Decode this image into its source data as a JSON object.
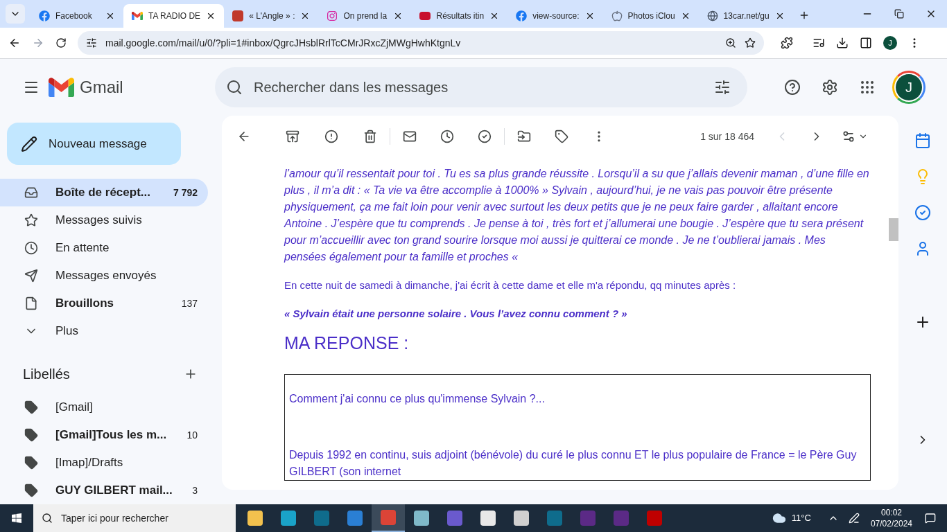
{
  "browser": {
    "tabs": [
      {
        "kind": "facebook",
        "title": "Facebook",
        "selected": false
      },
      {
        "kind": "gmail",
        "title": "TA RADIO DE",
        "selected": true
      },
      {
        "kind": "news",
        "title": "« L'Angle » :",
        "selected": false
      },
      {
        "kind": "instagram",
        "title": "On prend la",
        "selected": false
      },
      {
        "kind": "train",
        "title": "Résultats itin",
        "selected": false
      },
      {
        "kind": "facebook",
        "title": "view-source:",
        "selected": false
      },
      {
        "kind": "apple",
        "title": "Photos iClou",
        "selected": false
      },
      {
        "kind": "globe",
        "title": "13car.net/gu",
        "selected": false
      }
    ],
    "url": "mail.google.com/mail/u/0/?pli=1#inbox/QgrcJHsblRrlTcCMrJRxcZjMWgHwhKtgnLv",
    "profile_initial": "J"
  },
  "gmail": {
    "logo_text": "Gmail",
    "search_placeholder": "Rechercher dans les messages",
    "account_initial": "J",
    "compose_label": "Nouveau message",
    "nav": [
      {
        "kind": "inbox",
        "label": "Boîte de récept...",
        "count": "7 792",
        "bold": true,
        "selected": true
      },
      {
        "kind": "star",
        "label": "Messages suivis",
        "bold": false,
        "selected": false
      },
      {
        "kind": "clock",
        "label": "En attente",
        "bold": false,
        "selected": false
      },
      {
        "kind": "send",
        "label": "Messages envoyés",
        "bold": false,
        "selected": false
      },
      {
        "kind": "file",
        "label": "Brouillons",
        "count": "137",
        "bold": true,
        "selected": false
      },
      {
        "kind": "chevron",
        "label": "Plus",
        "bold": false,
        "selected": false
      }
    ],
    "labels_title": "Libellés",
    "labels": [
      {
        "label": "[Gmail]",
        "bold": false
      },
      {
        "label": "[Gmail]Tous les m...",
        "count": "10",
        "bold": true
      },
      {
        "label": "[Imap]/Drafts",
        "bold": false
      },
      {
        "label": "GUY GILBERT mail...",
        "count": "3",
        "bold": true
      }
    ],
    "pagination": "1 sur 18 464"
  },
  "email": {
    "quote_paragraph": "l’amour qu’il ressentait pour toi . Tu es sa plus grande réussite . Lorsqu’il a su que j’allais devenir maman , d’une fille en plus , il m’a dit : « Ta vie va être accomplie à 1000% » Sylvain , aujourd’hui, je ne vais pas pouvoir être présente physiquement, ça me fait loin pour venir avec surtout les deux petits que je ne peux faire garder , allaitant encore Antoine . J’espère que tu comprends . Je pense à toi , très fort et j’allumerai une bougie . J’espère que tu sera présent pour m’accueillir avec ton grand sourire lorsque moi aussi je quitterai ce monde . Je ne t’oublierai jamais . Mes pensées également pour ta famille et proches «",
    "paragraph": "En cette nuit de samedi à dimanche, j'ai écrit à cette dame et elle m'a répondu, qq minutes après :",
    "reply_quote": "« Sylvain était une personne solaire . Vous l’avez connu comment ? »",
    "heading": "MA REPONSE :",
    "box_lines": [
      "Comment j'ai connu ce plus qu'immense Sylvain ?...",
      "Depuis 1992 en continu, suis adjoint (bénévole) du curé le plus connu ET le plus populaire de France = le Père Guy GILBERT (son internet"
    ]
  },
  "taskbar": {
    "search_placeholder": "Taper ici pour rechercher",
    "apps": [
      {
        "kind": "explorer",
        "selected": false
      },
      {
        "kind": "edge",
        "selected": false
      },
      {
        "kind": "app",
        "selected": false
      },
      {
        "kind": "mail",
        "selected": false
      },
      {
        "kind": "chrome",
        "selected": true
      },
      {
        "kind": "notes",
        "selected": false
      },
      {
        "kind": "media",
        "selected": false
      },
      {
        "kind": "store",
        "selected": false
      },
      {
        "kind": "doc",
        "selected": false
      },
      {
        "kind": "app",
        "selected": false
      },
      {
        "kind": "purple",
        "selected": false
      },
      {
        "kind": "purple",
        "selected": false
      },
      {
        "kind": "filezilla",
        "selected": false
      }
    ],
    "temperature": "11°C",
    "time": "00:02",
    "date": "07/02/2024"
  }
}
